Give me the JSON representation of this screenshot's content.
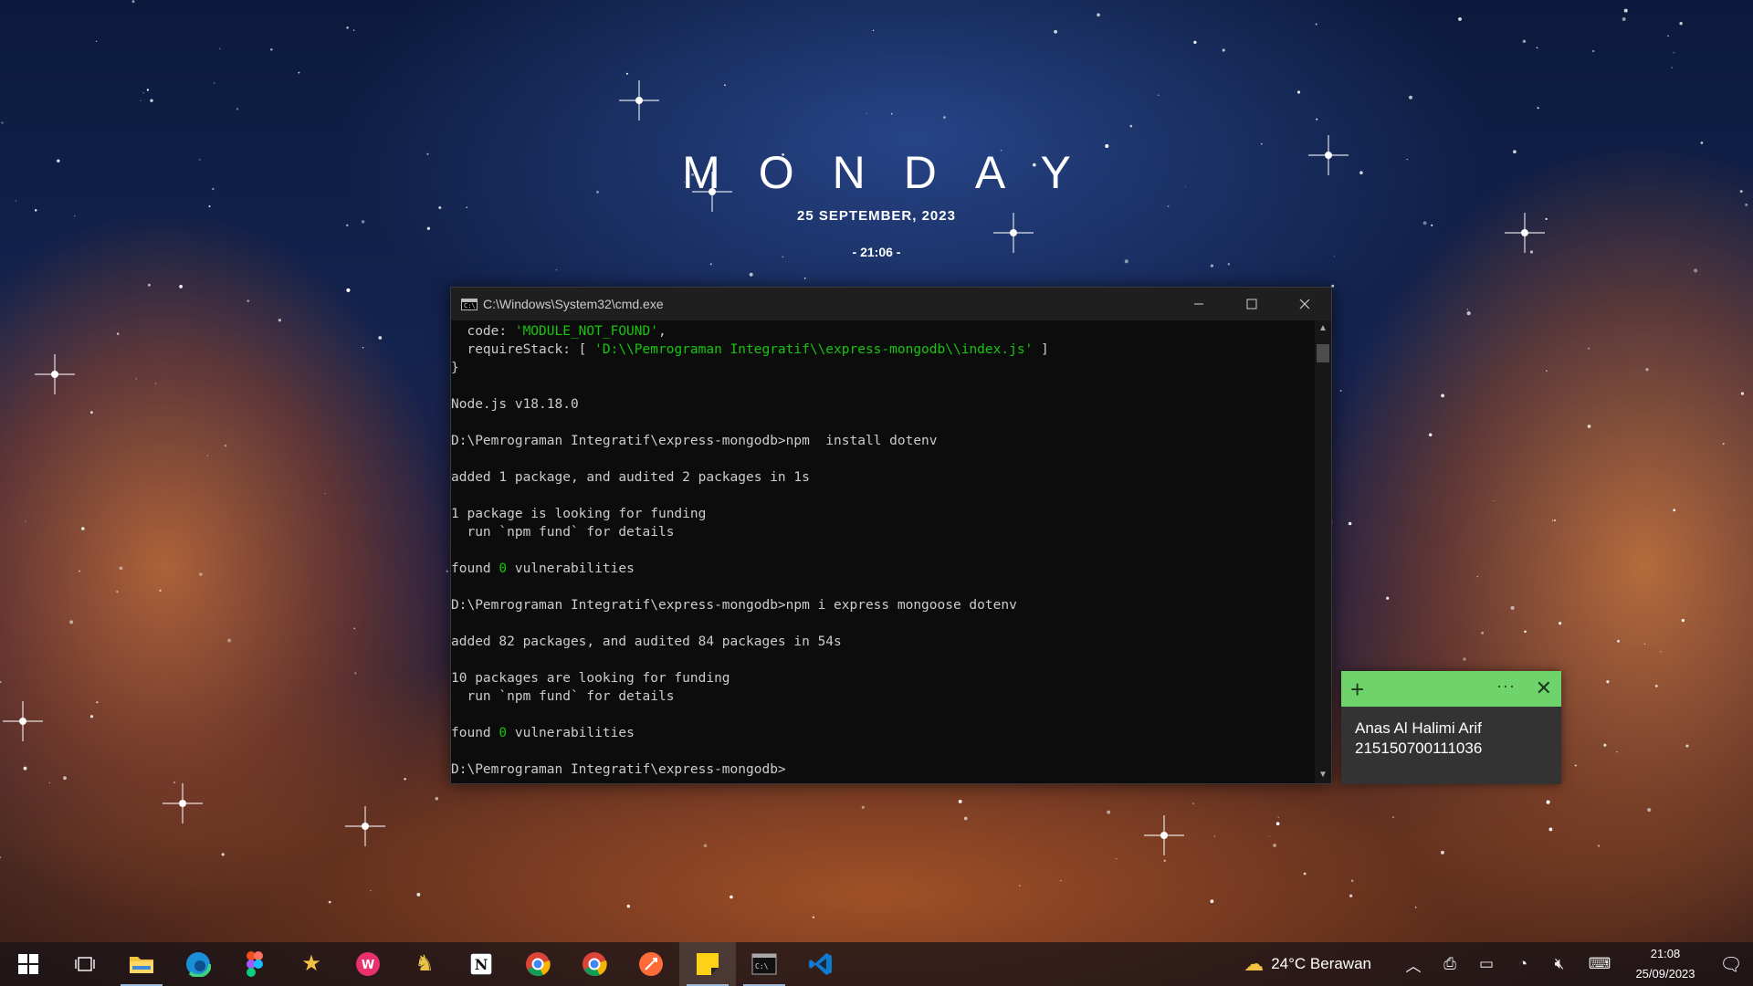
{
  "desktop": {
    "clock_day": "MONDAY",
    "clock_date": "25 SEPTEMBER, 2023",
    "clock_time": "- 21:06 -"
  },
  "cmd_window": {
    "title": "C:\\Windows\\System32\\cmd.exe",
    "lines": [
      [
        {
          "t": "  code: "
        },
        {
          "t": "'MODULE_NOT_FOUND'",
          "c": "green"
        },
        {
          "t": ","
        }
      ],
      [
        {
          "t": "  requireStack: [ "
        },
        {
          "t": "'D:\\\\Pemrograman Integratif\\\\express-mongodb\\\\index.js'",
          "c": "green"
        },
        {
          "t": " ]"
        }
      ],
      [
        {
          "t": "}"
        }
      ],
      [
        {
          "t": ""
        }
      ],
      [
        {
          "t": "Node.js v18.18.0"
        }
      ],
      [
        {
          "t": ""
        }
      ],
      [
        {
          "t": "D:\\Pemrograman Integratif\\express-mongodb>npm  install dotenv"
        }
      ],
      [
        {
          "t": ""
        }
      ],
      [
        {
          "t": "added 1 package, and audited 2 packages in 1s"
        }
      ],
      [
        {
          "t": ""
        }
      ],
      [
        {
          "t": "1 package is looking for funding"
        }
      ],
      [
        {
          "t": "  run `npm fund` for details"
        }
      ],
      [
        {
          "t": ""
        }
      ],
      [
        {
          "t": "found "
        },
        {
          "t": "0",
          "c": "green"
        },
        {
          "t": " vulnerabilities"
        }
      ],
      [
        {
          "t": ""
        }
      ],
      [
        {
          "t": "D:\\Pemrograman Integratif\\express-mongodb>npm i express mongoose dotenv"
        }
      ],
      [
        {
          "t": ""
        }
      ],
      [
        {
          "t": "added 82 packages, and audited 84 packages in 54s"
        }
      ],
      [
        {
          "t": ""
        }
      ],
      [
        {
          "t": "10 packages are looking for funding"
        }
      ],
      [
        {
          "t": "  run `npm fund` for details"
        }
      ],
      [
        {
          "t": ""
        }
      ],
      [
        {
          "t": "found "
        },
        {
          "t": "0",
          "c": "green"
        },
        {
          "t": " vulnerabilities"
        }
      ],
      [
        {
          "t": ""
        }
      ],
      [
        {
          "t": "D:\\Pemrograman Integratif\\express-mongodb>"
        }
      ]
    ]
  },
  "sticky_note": {
    "line1": "Anas Al Halimi Arif",
    "line2": "215150700111036",
    "header_color": "#6dd36a"
  },
  "taskbar": {
    "apps": [
      {
        "name": "start-button",
        "icon": "windows-icon"
      },
      {
        "name": "task-view-button",
        "icon": "task-view-icon"
      },
      {
        "name": "file-explorer",
        "icon": "folder-icon",
        "running": true
      },
      {
        "name": "edge",
        "icon": "edge-icon"
      },
      {
        "name": "figma",
        "icon": "figma-icon"
      },
      {
        "name": "starred-app",
        "icon": "star-icon"
      },
      {
        "name": "wps-office",
        "icon": "wps-icon"
      },
      {
        "name": "game-app",
        "icon": "character-icon"
      },
      {
        "name": "notion",
        "icon": "notion-icon"
      },
      {
        "name": "chrome-profile-1",
        "icon": "chrome-icon"
      },
      {
        "name": "chrome-profile-2",
        "icon": "chrome-icon"
      },
      {
        "name": "postman",
        "icon": "postman-icon"
      },
      {
        "name": "sticky-notes",
        "icon": "sticky-notes-icon",
        "running": true,
        "active": true
      },
      {
        "name": "command-prompt",
        "icon": "terminal-icon",
        "running": true
      },
      {
        "name": "vscode",
        "icon": "vscode-icon"
      }
    ],
    "weather_text": "24°C  Berawan",
    "clock_time": "21:08",
    "clock_date": "25/09/2023"
  }
}
